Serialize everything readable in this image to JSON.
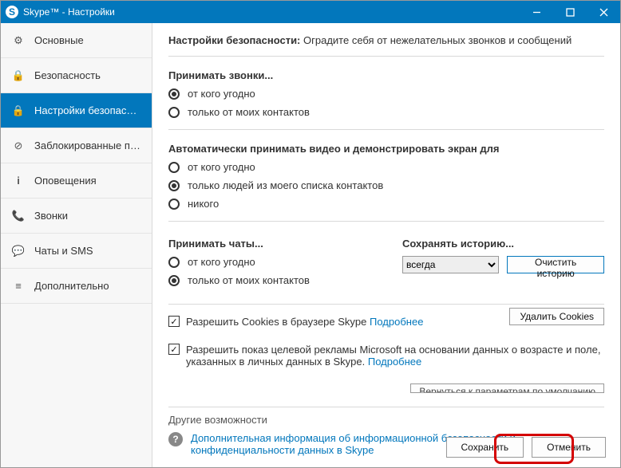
{
  "window": {
    "title": "Skype™ - Настройки"
  },
  "sidebar": {
    "items": [
      {
        "label": "Основные",
        "icon": "gear"
      },
      {
        "label": "Безопасность",
        "icon": "lock"
      },
      {
        "label": "Настройки безопасно...",
        "icon": "lock",
        "active": true
      },
      {
        "label": "Заблокированные по...",
        "icon": "blocked"
      },
      {
        "label": "Оповещения",
        "icon": "info"
      },
      {
        "label": "Звонки",
        "icon": "phone"
      },
      {
        "label": "Чаты и SMS",
        "icon": "chat"
      },
      {
        "label": "Дополнительно",
        "icon": "more"
      }
    ]
  },
  "header": {
    "bold": "Настройки безопасности:",
    "rest": " Оградите себя от нежелательных звонков и сообщений"
  },
  "calls": {
    "title": "Принимать звонки...",
    "o1": "от кого угодно",
    "o2": "только от моих контактов"
  },
  "video": {
    "title": "Автоматически принимать видео и демонстрировать экран для",
    "o1": "от кого угодно",
    "o2": "только людей из моего списка контактов",
    "o3": "никого"
  },
  "chats": {
    "title": "Принимать чаты...",
    "o1": "от кого угодно",
    "o2": "только от моих контактов"
  },
  "history": {
    "title": "Сохранять историю...",
    "selected": "всегда",
    "clear_btn": "Очистить историю"
  },
  "cookies": {
    "check1": "Разрешить Cookies в браузере Skype ",
    "check2a": "Разрешить показ целевой рекламы Microsoft на основании данных о возрасте и поле, указанных в личных данных в Skype. ",
    "more": "Подробнее",
    "delete_btn": "Удалить Cookies"
  },
  "cutoff_btn": "Вернуться к параметрам по умолчанию",
  "other": {
    "title": "Другие возможности",
    "link": "Дополнительная информация об информационной безопасности и конфиденциальности данных в Skype"
  },
  "footer": {
    "save": "Сохранить",
    "cancel": "Отменить"
  }
}
